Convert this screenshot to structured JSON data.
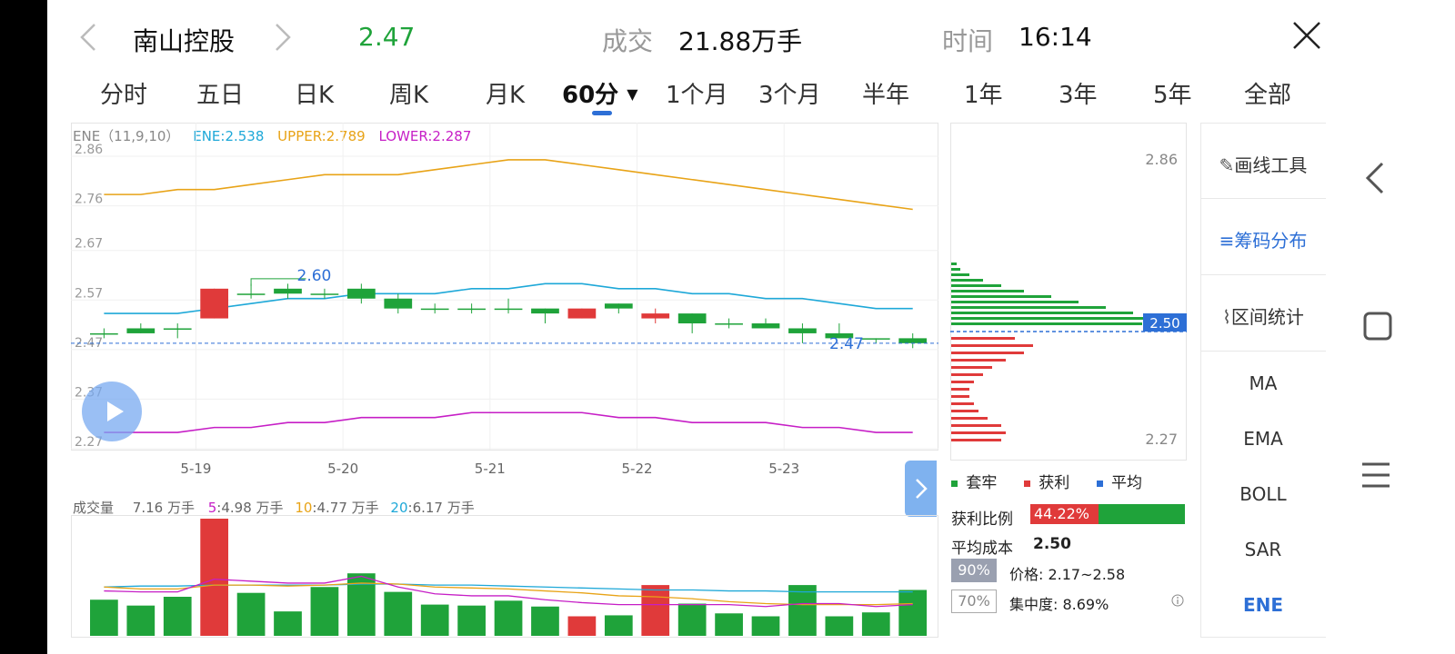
{
  "header": {
    "stock_name": "南山控股",
    "price": "2.47",
    "volume_label": "成交",
    "volume_value": "21.88万手",
    "time_label": "时间",
    "time_value": "16:14"
  },
  "tabs": [
    {
      "label": "分时"
    },
    {
      "label": "五日"
    },
    {
      "label": "日K"
    },
    {
      "label": "周K"
    },
    {
      "label": "月K"
    },
    {
      "label": "60分",
      "active": true
    },
    {
      "label": "1个月"
    },
    {
      "label": "3个月"
    },
    {
      "label": "半年"
    },
    {
      "label": "1年"
    },
    {
      "label": "3年"
    },
    {
      "label": "5年"
    },
    {
      "label": "全部"
    }
  ],
  "indicator": {
    "name": "ENE（11,9,10）",
    "ene": "ENE:2.538",
    "upper": "UPPER:2.789",
    "lower": "LOWER:2.287",
    "colors": {
      "ene": "#1ea8d8",
      "upper": "#e8a317",
      "lower": "#c61ec6"
    }
  },
  "volume_header": {
    "label": "成交量",
    "value": "7.16 万手",
    "ma5_key": "5",
    "ma5": ":4.98 万手",
    "ma10_key": "10",
    "ma10": ":4.77 万手",
    "ma20_key": "20",
    "ma20": ":6.17 万手"
  },
  "chip": {
    "top_price": "2.86",
    "bottom_price": "2.27",
    "avg_price_tag": "2.50",
    "legend": [
      "套牢",
      "获利",
      "平均"
    ],
    "profit_ratio_label": "获利比例",
    "profit_ratio": "44.22%",
    "profit_fraction": 0.4422,
    "avg_cost_label": "平均成本",
    "avg_cost": "2.50",
    "pct90": "90%",
    "range_text": "价格: 2.17~2.58",
    "pct70": "70%",
    "concentration_text": "集中度: 8.69%",
    "info_icon": "info-icon"
  },
  "sidebar": {
    "draw_tool": "画线工具",
    "chip_dist": "筹码分布",
    "interval_stats": "区间统计",
    "indicators": [
      "MA",
      "EMA",
      "BOLL",
      "SAR",
      "ENE"
    ],
    "active_indicator": "ENE"
  },
  "colors": {
    "up": "#e03a3a",
    "down": "#1fa33a",
    "accent": "#2d6fd6",
    "price_green": "#1fa33a"
  },
  "chart_data": {
    "type": "candlestick",
    "y_ticks": [
      "2.86",
      "2.76",
      "2.67",
      "2.57",
      "2.47",
      "2.37",
      "2.27"
    ],
    "x_ticks": [
      "5-19",
      "5-20",
      "5-21",
      "5-22",
      "5-23"
    ],
    "ylim": [
      2.27,
      2.86
    ],
    "annotations": {
      "high": "2.60",
      "last": "2.47"
    },
    "candles": [
      {
        "o": 2.49,
        "h": 2.5,
        "l": 2.48,
        "c": 2.49
      },
      {
        "o": 2.5,
        "h": 2.51,
        "l": 2.49,
        "c": 2.49
      },
      {
        "o": 2.5,
        "h": 2.51,
        "l": 2.48,
        "c": 2.5
      },
      {
        "o": 2.52,
        "h": 2.58,
        "l": 2.52,
        "c": 2.58
      },
      {
        "o": 2.57,
        "h": 2.59,
        "l": 2.56,
        "c": 2.57
      },
      {
        "o": 2.58,
        "h": 2.59,
        "l": 2.56,
        "c": 2.57
      },
      {
        "o": 2.57,
        "h": 2.58,
        "l": 2.56,
        "c": 2.57
      },
      {
        "o": 2.58,
        "h": 2.59,
        "l": 2.55,
        "c": 2.56
      },
      {
        "o": 2.56,
        "h": 2.57,
        "l": 2.53,
        "c": 2.54
      },
      {
        "o": 2.54,
        "h": 2.55,
        "l": 2.53,
        "c": 2.54
      },
      {
        "o": 2.54,
        "h": 2.55,
        "l": 2.53,
        "c": 2.54
      },
      {
        "o": 2.54,
        "h": 2.56,
        "l": 2.53,
        "c": 2.54
      },
      {
        "o": 2.54,
        "h": 2.54,
        "l": 2.51,
        "c": 2.53
      },
      {
        "o": 2.52,
        "h": 2.54,
        "l": 2.52,
        "c": 2.54
      },
      {
        "o": 2.55,
        "h": 2.55,
        "l": 2.53,
        "c": 2.54
      },
      {
        "o": 2.52,
        "h": 2.54,
        "l": 2.51,
        "c": 2.53
      },
      {
        "o": 2.53,
        "h": 2.53,
        "l": 2.49,
        "c": 2.51
      },
      {
        "o": 2.51,
        "h": 2.52,
        "l": 2.5,
        "c": 2.51
      },
      {
        "o": 2.51,
        "h": 2.52,
        "l": 2.5,
        "c": 2.5
      },
      {
        "o": 2.5,
        "h": 2.51,
        "l": 2.47,
        "c": 2.49
      },
      {
        "o": 2.49,
        "h": 2.51,
        "l": 2.48,
        "c": 2.48
      },
      {
        "o": 2.48,
        "h": 2.48,
        "l": 2.47,
        "c": 2.48
      },
      {
        "o": 2.48,
        "h": 2.49,
        "l": 2.46,
        "c": 2.47
      }
    ],
    "ene_series": {
      "upper": [
        2.77,
        2.77,
        2.78,
        2.78,
        2.79,
        2.8,
        2.81,
        2.81,
        2.81,
        2.82,
        2.83,
        2.84,
        2.84,
        2.83,
        2.82,
        2.81,
        2.8,
        2.79,
        2.78,
        2.77,
        2.76,
        2.75,
        2.74
      ],
      "ene": [
        2.53,
        2.53,
        2.53,
        2.54,
        2.55,
        2.56,
        2.56,
        2.57,
        2.57,
        2.57,
        2.58,
        2.58,
        2.59,
        2.59,
        2.58,
        2.58,
        2.57,
        2.57,
        2.56,
        2.56,
        2.55,
        2.54,
        2.54
      ],
      "lower": [
        2.29,
        2.29,
        2.29,
        2.3,
        2.3,
        2.31,
        2.31,
        2.32,
        2.32,
        2.32,
        2.33,
        2.33,
        2.33,
        2.33,
        2.32,
        2.32,
        2.31,
        2.31,
        2.31,
        2.3,
        2.3,
        2.29,
        2.29
      ]
    },
    "volume": {
      "values": [
        3.7,
        3.1,
        4.0,
        12.0,
        4.4,
        2.5,
        5.0,
        6.4,
        4.5,
        3.2,
        3.1,
        3.6,
        3.0,
        2.0,
        2.1,
        5.2,
        3.3,
        2.3,
        2.0,
        5.2,
        2.0,
        2.4,
        4.7
      ],
      "ma5": [
        4.6,
        4.5,
        4.5,
        5.8,
        5.6,
        5.4,
        5.4,
        6.1,
        5.0,
        4.3,
        4.1,
        4.1,
        3.7,
        3.4,
        3.2,
        3.2,
        3.2,
        3.2,
        3.0,
        3.3,
        3.3,
        3.0,
        3.2
      ],
      "ma10": [
        5.0,
        4.8,
        4.8,
        5.2,
        5.2,
        5.1,
        5.2,
        5.4,
        5.3,
        5.0,
        4.9,
        4.8,
        4.6,
        4.4,
        4.1,
        4.0,
        3.8,
        3.5,
        3.3,
        3.2,
        3.2,
        3.2,
        3.3
      ],
      "ma20": [
        5.0,
        5.1,
        5.1,
        5.2,
        5.2,
        5.2,
        5.2,
        5.3,
        5.3,
        5.2,
        5.2,
        5.1,
        5.0,
        4.9,
        4.8,
        4.7,
        4.7,
        4.6,
        4.6,
        4.5,
        4.5,
        4.5,
        4.5
      ],
      "ylim": [
        0,
        12
      ]
    },
    "chip_bars": {
      "trapped": [
        6,
        10,
        20,
        35,
        55,
        80,
        110,
        140,
        170,
        200,
        220,
        210
      ],
      "profit": [
        70,
        90,
        80,
        60,
        45,
        35,
        25,
        20,
        20,
        25,
        30,
        40,
        55,
        60,
        55
      ]
    }
  }
}
